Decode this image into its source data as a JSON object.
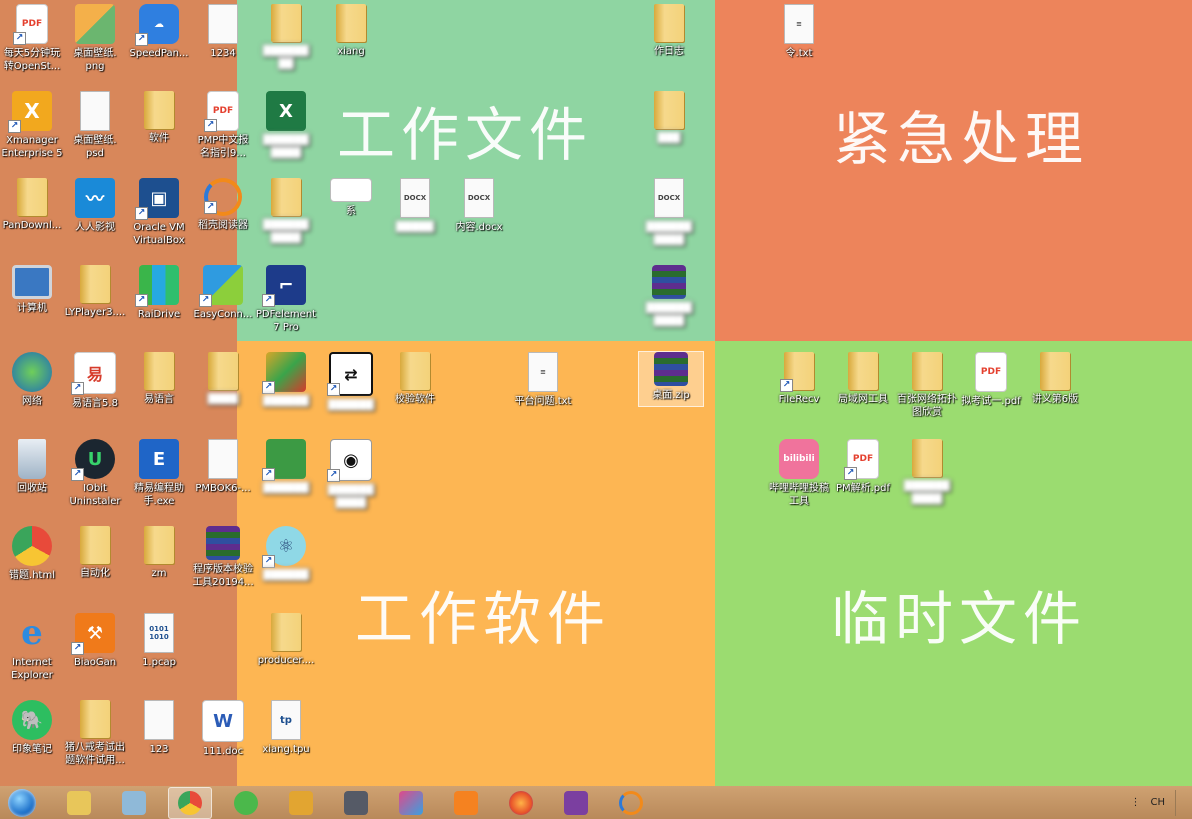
{
  "zones": {
    "work_files": "工作文件",
    "urgent": "紧急处理",
    "work_software": "工作软件",
    "temp_files": "临时文件"
  },
  "colors": {
    "left": "#d8875a",
    "work_files": "#8fd5a2",
    "urgent": "#ed845b",
    "work_software": "#fdb653",
    "temp_files": "#9bdc70"
  },
  "left_icons": [
    {
      "id": "pdf-1",
      "label": "每天5分钟玩\n转OpenSt...",
      "icon": "pdf-icon"
    },
    {
      "id": "png-1",
      "label": "桌面壁纸.\npng",
      "icon": "image-icon"
    },
    {
      "id": "speedpan",
      "label": "SpeedPan...",
      "icon": "cloud-icon"
    },
    {
      "id": "f1234",
      "label": "1234",
      "icon": "blank-file-icon"
    },
    {
      "id": "xmanager",
      "label": "Xmanager\nEnterprise 5",
      "icon": "xmanager-icon"
    },
    {
      "id": "psd",
      "label": "桌面壁纸.\npsd",
      "icon": "blank-file-icon"
    },
    {
      "id": "software",
      "label": "软件",
      "icon": "folder-icon"
    },
    {
      "id": "pmp",
      "label": "PMP中文报\n名指引9...",
      "icon": "pdf-icon"
    },
    {
      "id": "pandownload",
      "label": "PanDownl...",
      "icon": "folder-icon"
    },
    {
      "id": "renren",
      "label": "人人影视",
      "icon": "renren-icon"
    },
    {
      "id": "virtualbox",
      "label": "Oracle VM\nVirtualBox",
      "icon": "virtualbox-icon"
    },
    {
      "id": "daoke",
      "label": "稻壳阅读器",
      "icon": "reader-icon"
    },
    {
      "id": "computer",
      "label": "计算机",
      "icon": "computer-icon"
    },
    {
      "id": "lyplayer",
      "label": "LYPlayer3....",
      "icon": "folder-icon"
    },
    {
      "id": "raidrive",
      "label": "RaiDrive",
      "icon": "raidrive-icon"
    },
    {
      "id": "easyconn",
      "label": "EasyConn...",
      "icon": "easyconnect-icon"
    },
    {
      "id": "network",
      "label": "网络",
      "icon": "network-icon"
    },
    {
      "id": "yiyuyan58",
      "label": "易语言5.8",
      "icon": "yiyuyan-icon"
    },
    {
      "id": "yiyuyan",
      "label": "易语言",
      "icon": "folder-icon"
    },
    {
      "id": "recycle",
      "label": "回收站",
      "icon": "recycle-bin-icon"
    },
    {
      "id": "iobit",
      "label": "IObit\nUninstaler",
      "icon": "iobit-icon"
    },
    {
      "id": "jingyi",
      "label": "精易编程助\n手.exe",
      "icon": "jingyi-icon"
    },
    {
      "id": "pmbok",
      "label": "PMBOK6-...",
      "icon": "blank-file-icon"
    },
    {
      "id": "html",
      "label": "错题.html",
      "icon": "chrome-icon"
    },
    {
      "id": "zidonghua",
      "label": "自动化",
      "icon": "folder-icon"
    },
    {
      "id": "zm",
      "label": "zm",
      "icon": "folder-icon"
    },
    {
      "id": "rar-tool",
      "label": "程序版本校验\n工具20194...",
      "icon": "winrar-icon"
    },
    {
      "id": "ie",
      "label": "Internet\nExplorer",
      "icon": "ie-icon"
    },
    {
      "id": "biaogan",
      "label": "BiaoGan",
      "icon": "biaogan-icon"
    },
    {
      "id": "pcap",
      "label": "1.pcap",
      "icon": "binary-file-icon"
    },
    {
      "id": "evernote",
      "label": "印象笔记",
      "icon": "evernote-icon"
    },
    {
      "id": "zhubajie",
      "label": "猪八戒考试出\n题软件试用...",
      "icon": "folder-icon"
    },
    {
      "id": "f123",
      "label": "123",
      "icon": "blank-file-icon"
    },
    {
      "id": "doc111",
      "label": "111.doc",
      "icon": "word-icon"
    }
  ],
  "work_files_icons": [
    {
      "id": "wf-folder-1",
      "label": "",
      "icon": "folder-icon",
      "blurred": true
    },
    {
      "id": "xiang",
      "label": "xiang",
      "icon": "folder-icon"
    },
    {
      "id": "wf-folder-2",
      "label": "作日志",
      "icon": "folder-icon",
      "blurred": true
    },
    {
      "id": "wf-xlsx",
      "label": "",
      "icon": "excel-icon",
      "blurred": true
    },
    {
      "id": "wf-folder-3",
      "label": "",
      "icon": "folder-icon",
      "blurred": true
    },
    {
      "id": "wf-folder-4",
      "label": "",
      "icon": "folder-icon",
      "blurred": true
    },
    {
      "id": "wf-img",
      "label": "系",
      "icon": "image-icon",
      "blurred": true
    },
    {
      "id": "wf-docx-1",
      "label": "",
      "icon": "docx-icon",
      "blurred": true
    },
    {
      "id": "wf-docx-2",
      "label": "内容.docx",
      "icon": "docx-icon"
    },
    {
      "id": "wf-docx-3",
      "label": "",
      "icon": "docx-icon",
      "blurred": true
    },
    {
      "id": "pdfelement",
      "label": "PDFelement\n7 Pro",
      "icon": "pdfelement-icon"
    },
    {
      "id": "wf-rar",
      "label": "",
      "icon": "winrar-icon",
      "blurred": true
    }
  ],
  "urgent_icons": [
    {
      "id": "urg-txt",
      "label": "令.txt",
      "icon": "text-file-icon"
    }
  ],
  "software_icons": [
    {
      "id": "sw-1",
      "label": "",
      "icon": "folder-icon",
      "blurred": true
    },
    {
      "id": "sw-2",
      "label": "",
      "icon": "network-tool-icon",
      "blurred": true
    },
    {
      "id": "sw-3",
      "label": "",
      "icon": "compare-icon",
      "blurred": true
    },
    {
      "id": "jiaoyan",
      "label": "校验软件",
      "icon": "folder-icon"
    },
    {
      "id": "pingtai",
      "label": "平台问题.txt",
      "icon": "text-file-icon"
    },
    {
      "id": "zhuomian-zip",
      "label": "桌面.zip",
      "icon": "winrar-icon"
    },
    {
      "id": "sw-4",
      "label": "",
      "icon": "app-icon",
      "blurred": true
    },
    {
      "id": "sw-5",
      "label": "",
      "icon": "capture-icon",
      "blurred": true
    },
    {
      "id": "sw-6",
      "label": "",
      "icon": "electron-icon",
      "blurred": true
    },
    {
      "id": "producer",
      "label": "producer....",
      "icon": "folder-icon"
    },
    {
      "id": "xiang-tpu",
      "label": "xiang.tpu",
      "icon": "tpu-file-icon"
    }
  ],
  "temp_icons": [
    {
      "id": "filerecv",
      "label": "FileRecv",
      "icon": "folder-icon"
    },
    {
      "id": "jvyu",
      "label": "局域网工具",
      "icon": "folder-icon"
    },
    {
      "id": "baizhang",
      "label": "百张网络拓扑\n图欣赏",
      "icon": "folder-icon"
    },
    {
      "id": "tmp-pdf-1",
      "label": "拟考试一.pdf",
      "icon": "pdf-icon"
    },
    {
      "id": "tmp-folder",
      "label": "讲义第6版",
      "icon": "folder-icon"
    },
    {
      "id": "bilibili",
      "label": "哔哩哔哩投稿\n工具",
      "icon": "bilibili-icon"
    },
    {
      "id": "pm-pdf",
      "label": "PM解析.pdf",
      "icon": "pdf-icon"
    },
    {
      "id": "tmp-folder-2",
      "label": "",
      "icon": "folder-icon",
      "blurred": true
    }
  ],
  "taskbar": {
    "items": [
      {
        "name": "explorer-icon",
        "color": "#e8c65a"
      },
      {
        "name": "pin-icon",
        "color": "#8fb9d8"
      },
      {
        "name": "chrome-icon",
        "color": "#e84a3a",
        "active": true
      },
      {
        "name": "sync-icon",
        "color": "#4bb84b"
      },
      {
        "name": "search-tool-icon",
        "color": "#e2a531"
      },
      {
        "name": "window-icon",
        "color": "#555a66"
      },
      {
        "name": "xmind-icon",
        "color": "#e04a8a"
      },
      {
        "name": "calendar-icon",
        "color": "#f58220"
      },
      {
        "name": "firefox-icon",
        "color": "#e8542a"
      },
      {
        "name": "onenote-icon",
        "color": "#7b3fa0"
      },
      {
        "name": "reader-icon",
        "color": "#2d7ad8"
      }
    ],
    "lang": "CH"
  }
}
